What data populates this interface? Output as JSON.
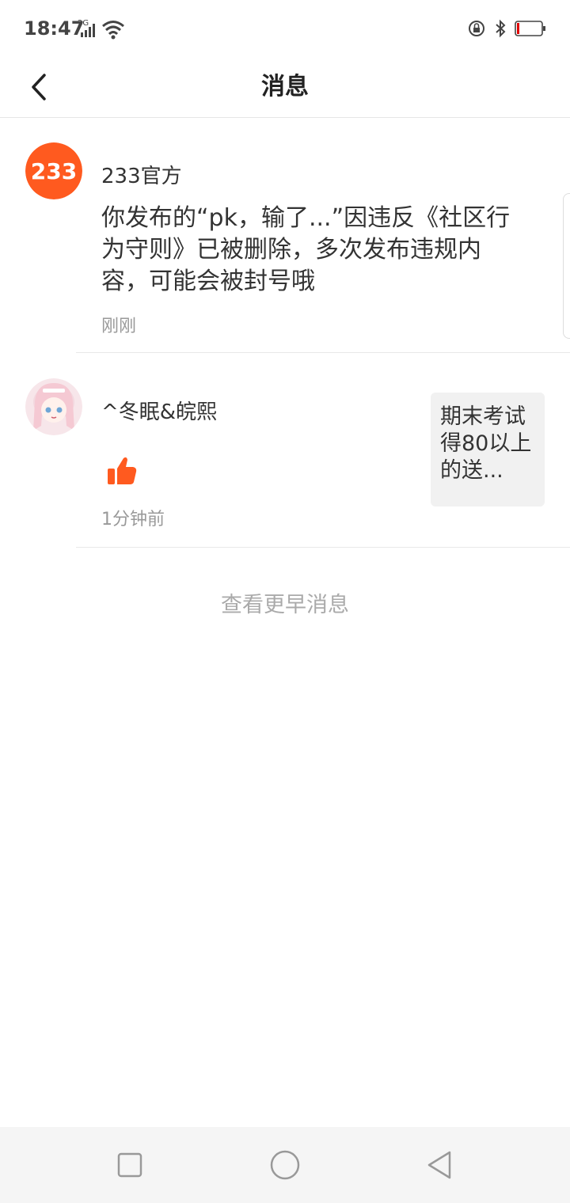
{
  "status_bar": {
    "time": "18:47",
    "network": "2G",
    "battery_level": 0.1,
    "battery_color": "#e00000"
  },
  "header": {
    "title": "消息"
  },
  "messages": [
    {
      "avatar_text": "233",
      "sender": "233官方",
      "text": "你发布的“pk，输了...”因违反《社区行为守则》已被删除，多次发布违规内容，可能会被封号哦",
      "time": "刚刚"
    },
    {
      "sender": "^冬眠&皖熙",
      "action_icon": "thumbs-up-icon",
      "time": "1分钟前",
      "ref_text": "期末考试得80以上的送..."
    }
  ],
  "more_link": "查看更早消息",
  "colors": {
    "brand": "#ff5a1f",
    "like": "#ff5a1f"
  }
}
